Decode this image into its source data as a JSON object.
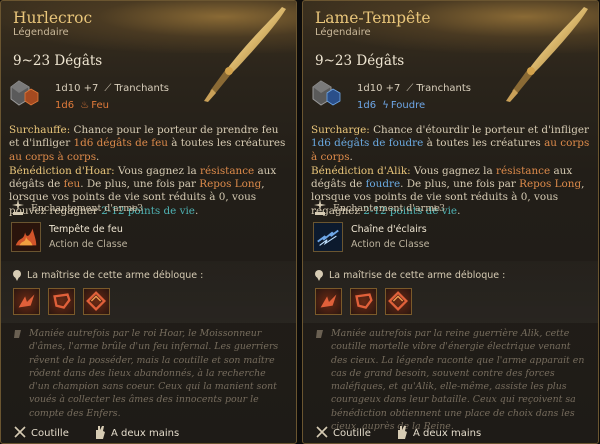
{
  "cards": [
    {
      "name": "Hurlecroc",
      "rarity": "Légendaire",
      "damage_total": "9~23 Dégâts",
      "damage_main": "1d10 +7",
      "damage_main_type": "Tranchants",
      "damage_extra_dice": "1d6",
      "damage_extra_type": "Feu",
      "passive1_name": "Surchauffe:",
      "passive1_text_a": " Chance pour le porteur de prendre feu et d'infliger ",
      "passive1_kw": "1d6 dégâts de feu",
      "passive1_text_b": " à toutes les créatures ",
      "passive1_kw2": "au corps à corps",
      "passive1_text_c": ".",
      "passive2_name": "Bénédiction d'Hoar:",
      "passive2_text_a": " Vous gagnez la ",
      "passive2_kw": "résistance",
      "passive2_text_b": " aux dégâts de ",
      "passive2_kw2": "feu",
      "passive2_text_c": ". De plus, une fois par ",
      "passive2_kw3": "Repos Long",
      "passive2_text_d": ", lorsque vos points de vie sont réduits à 0, vous pouvez regagner ",
      "passive2_kw4": "2-12 points de vie",
      "passive2_text_e": ".",
      "enchantment_label": "Enchantement d'arme",
      "enchantment_value": "+3",
      "action_name": "Tempête de feu",
      "action_type": "Action de Classe",
      "mastery_label": "La maîtrise de cette arme débloque :",
      "lore": "Maniée autrefois par le roi Hoar, le Moissonneur d'âmes, l'arme brûle d'un feu infernal. Les guerriers rêvent de la posséder, mais la coutille et son maître rôdent dans des lieux abandonnés, à la recherche d'un champion sans coeur. Ceux qui la manient sont voués à collecter les âmes des innocents pour le compte des Enfers.",
      "footer_type": "Coutille",
      "footer_hands": "A deux mains",
      "element": "fire"
    },
    {
      "name": "Lame-Tempête",
      "rarity": "Légendaire",
      "damage_total": "9~23 Dégâts",
      "damage_main": "1d10 +7",
      "damage_main_type": "Tranchants",
      "damage_extra_dice": "1d6",
      "damage_extra_type": "Foudre",
      "passive1_name": "Surcharge:",
      "passive1_text_a": " Chance d'étourdir le porteur et d'infliger ",
      "passive1_kw": "1d6 dégâts de foudre",
      "passive1_text_b": " à toutes les créatures ",
      "passive1_kw2": "au corps à corps",
      "passive1_text_c": ".",
      "passive2_name": "Bénédiction d'Alik:",
      "passive2_text_a": " Vous gagnez la ",
      "passive2_kw": "résistance",
      "passive2_text_b": " aux dégâts de ",
      "passive2_kw2": "foudre",
      "passive2_text_c": ". De plus, une fois par ",
      "passive2_kw3": "Repos Long",
      "passive2_text_d": ", lorsque vos points de vie sont réduits à 0, vous regagnez ",
      "passive2_kw4": "2-12 points de vie",
      "passive2_text_e": ".",
      "enchantment_label": "Enchantement d'arme",
      "enchantment_value": "+3",
      "action_name": "Chaîne d'éclairs",
      "action_type": "Action de Classe",
      "mastery_label": "La maîtrise de cette arme débloque :",
      "lore": "Maniée autrefois par la reine guerrière Alik, cette coutille mortelle vibre d'énergie électrique venant des cieux. La légende raconte que l'arme apparait en cas de grand besoin, souvent contre des forces maléfiques, et qu'Alik, elle-même, assiste les plus courageux dans leur bataille. Ceux qui reçoivent sa bénédiction obtiennent une place de choix dans les cieux, auprès de la Reine.",
      "footer_type": "Coutille",
      "footer_hands": "A deux mains",
      "element": "lightning"
    }
  ],
  "colors": {
    "name_gold": "#e8c57a",
    "fire": "#e07a3a",
    "lightning": "#6ea6e6",
    "teal": "#4fb3b3",
    "border": "#6a5530"
  },
  "icons": {
    "weapon": "glaive-icon",
    "die": "d10-die-icon",
    "slash": "slashing-icon",
    "fire": "fire-icon",
    "lightning": "lightning-icon",
    "enchant": "anvil-icon",
    "mastery": "pin-icon",
    "quote": "quote-icon",
    "type": "crossed-blades-icon",
    "hands": "two-hands-icon"
  }
}
